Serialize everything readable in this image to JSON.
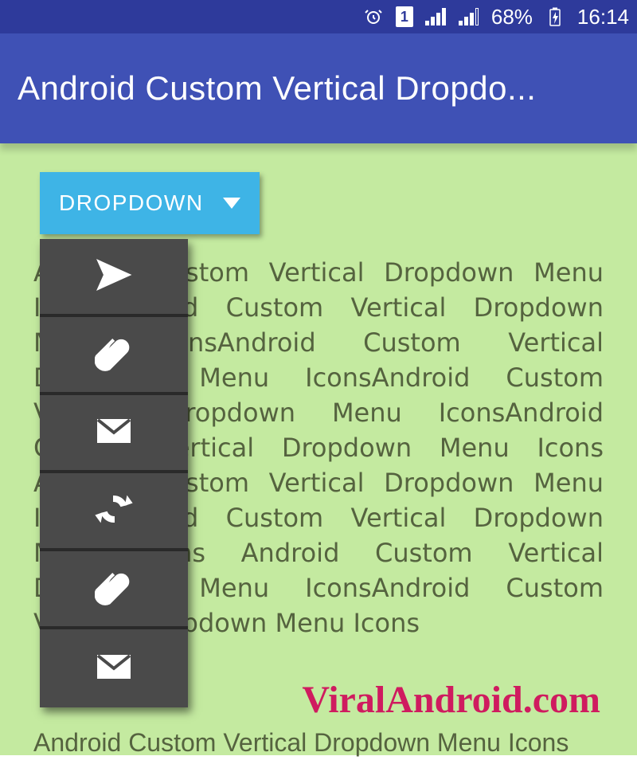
{
  "status": {
    "battery_pct": "68%",
    "time": "16:14",
    "sim_slot": "1"
  },
  "app_bar": {
    "title": "Android Custom Vertical Dropdo..."
  },
  "dropdown": {
    "button_label": "DROPDOWN",
    "items": [
      {
        "icon": "send-icon"
      },
      {
        "icon": "paperclip-icon"
      },
      {
        "icon": "mail-icon"
      },
      {
        "icon": "refresh-icon"
      },
      {
        "icon": "paperclip-icon"
      },
      {
        "icon": "mail-icon"
      }
    ]
  },
  "body": {
    "paragraph": "Android Custom Vertical Dropdown Menu IconsAndroid Custom Vertical Dropdown Menu IconsAndroid Custom Vertical Dropdown Menu IconsAndroid Custom Vertical Dropdown Menu IconsAndroid Custom Vertical Dropdown Menu Icons Android Custom Vertical Dropdown Menu IconsAndroid Custom Vertical Dropdown Menu Icons Android Custom Vertical Dropdown Menu IconsAndroid Custom Vertical Dropdown Menu Icons",
    "paragraph2": "Android Custom Vertical Dropdown Menu Icons"
  },
  "watermark": "ViralAndroid.com",
  "colors": {
    "primary": "#3f51b5",
    "primary_dark": "#2e3a9b",
    "accent": "#3eb4e6",
    "content_bg": "#c4eaa0",
    "menu_bg": "#4a4a4a",
    "watermark": "#cf1b5f"
  }
}
